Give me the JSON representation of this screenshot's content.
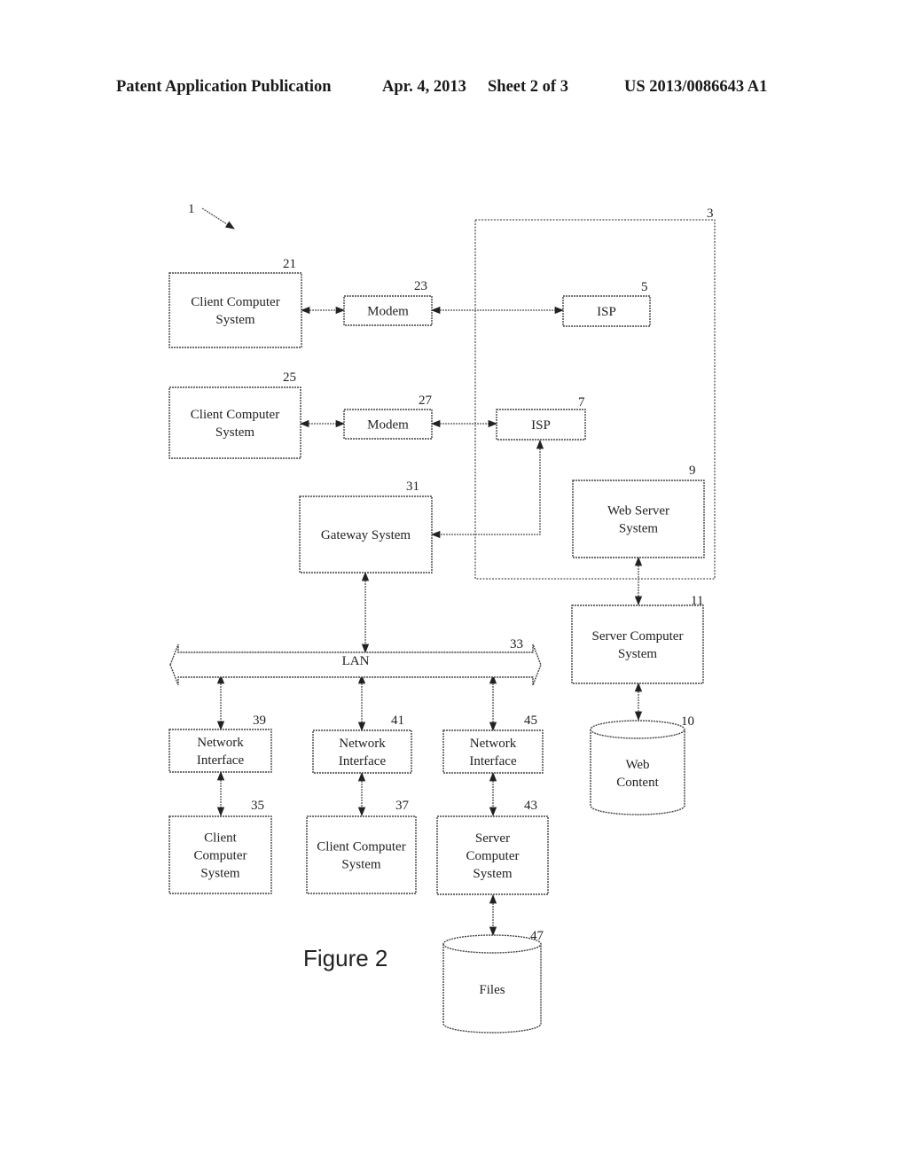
{
  "header": {
    "publication": "Patent Application Publication",
    "date": "Apr. 4, 2013",
    "sheet": "Sheet 2 of 3",
    "number": "US 2013/0086643 A1"
  },
  "figure": {
    "caption": "Figure 2",
    "overall_ref": "1",
    "internet_ref": "3",
    "nodes": [
      {
        "id": "client21",
        "ref": "21",
        "lines": [
          "Client Computer",
          "System"
        ]
      },
      {
        "id": "modem23",
        "ref": "23",
        "lines": [
          "Modem"
        ]
      },
      {
        "id": "isp5",
        "ref": "5",
        "lines": [
          "ISP"
        ]
      },
      {
        "id": "client25",
        "ref": "25",
        "lines": [
          "Client Computer",
          "System"
        ]
      },
      {
        "id": "modem27",
        "ref": "27",
        "lines": [
          "Modem"
        ]
      },
      {
        "id": "isp7",
        "ref": "7",
        "lines": [
          "ISP"
        ]
      },
      {
        "id": "gateway31",
        "ref": "31",
        "lines": [
          "Gateway System"
        ]
      },
      {
        "id": "webserver9",
        "ref": "9",
        "lines": [
          "Web Server",
          "System"
        ]
      },
      {
        "id": "server11",
        "ref": "11",
        "lines": [
          "Server Computer",
          "System"
        ]
      },
      {
        "id": "webcontent10",
        "ref": "10",
        "lines": [
          "Web",
          "Content"
        ],
        "shape": "cylinder"
      },
      {
        "id": "lan33",
        "ref": "33",
        "lines": [
          "LAN"
        ],
        "shape": "bus"
      },
      {
        "id": "netif39",
        "ref": "39",
        "lines": [
          "Network",
          "Interface"
        ]
      },
      {
        "id": "netif41",
        "ref": "41",
        "lines": [
          "Network",
          "Interface"
        ]
      },
      {
        "id": "netif45",
        "ref": "45",
        "lines": [
          "Network",
          "Interface"
        ]
      },
      {
        "id": "client35",
        "ref": "35",
        "lines": [
          "Client",
          "Computer",
          "System"
        ]
      },
      {
        "id": "client37",
        "ref": "37",
        "lines": [
          "Client Computer",
          "System"
        ]
      },
      {
        "id": "server43",
        "ref": "43",
        "lines": [
          "Server",
          "Computer",
          "System"
        ]
      },
      {
        "id": "files47",
        "ref": "47",
        "lines": [
          "Files"
        ],
        "shape": "cylinder"
      }
    ],
    "edges": [
      {
        "from": "client21",
        "to": "modem23",
        "bidirectional": true
      },
      {
        "from": "modem23",
        "to": "isp5",
        "bidirectional": true
      },
      {
        "from": "client25",
        "to": "modem27",
        "bidirectional": true
      },
      {
        "from": "modem27",
        "to": "isp7",
        "bidirectional": true
      },
      {
        "from": "isp7",
        "to": "gateway31",
        "bidirectional": true
      },
      {
        "from": "gateway31",
        "to": "lan33",
        "bidirectional": true
      },
      {
        "from": "webserver9",
        "to": "server11",
        "bidirectional": true
      },
      {
        "from": "server11",
        "to": "webcontent10",
        "bidirectional": true
      },
      {
        "from": "lan33",
        "to": "netif39",
        "bidirectional": true
      },
      {
        "from": "lan33",
        "to": "netif41",
        "bidirectional": true
      },
      {
        "from": "lan33",
        "to": "netif45",
        "bidirectional": true
      },
      {
        "from": "netif39",
        "to": "client35",
        "bidirectional": true
      },
      {
        "from": "netif41",
        "to": "client37",
        "bidirectional": true
      },
      {
        "from": "netif45",
        "to": "server43",
        "bidirectional": true
      },
      {
        "from": "server43",
        "to": "files47",
        "bidirectional": true
      }
    ]
  }
}
